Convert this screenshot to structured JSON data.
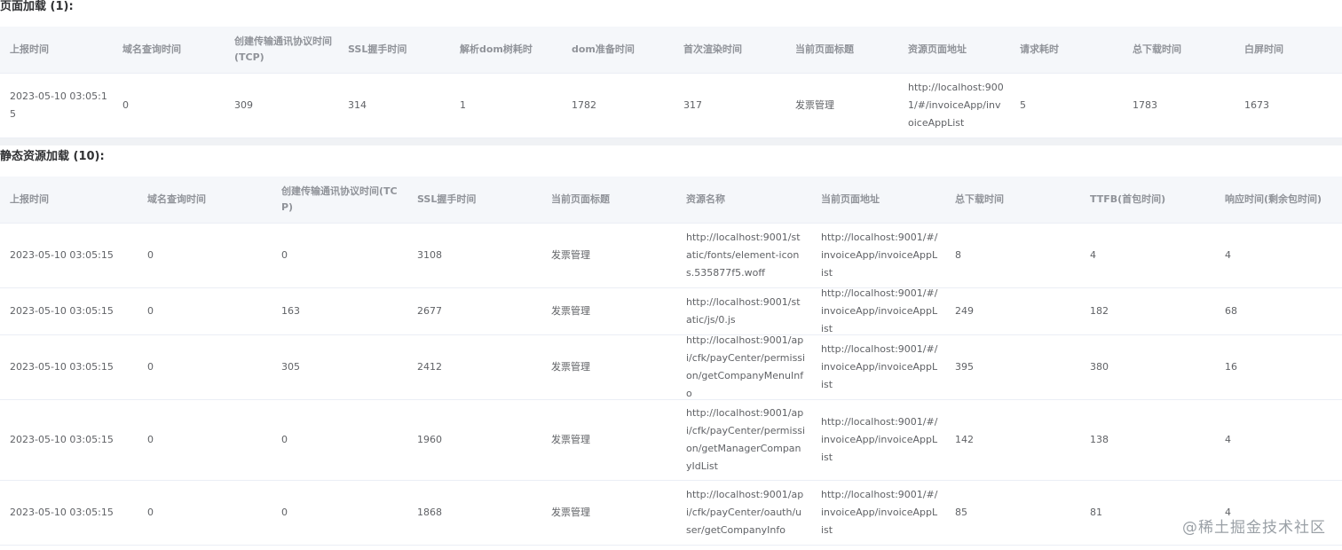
{
  "page_load": {
    "title": "页面加载 (1):",
    "columns": [
      "上报时间",
      "域名查询时间",
      "创建传输通讯协议时间(TCP)",
      "SSL握手时间",
      "解析dom树耗时",
      "dom准备时间",
      "首次渲染时间",
      "当前页面标题",
      "资源页面地址",
      "请求耗时",
      "总下载时间",
      "白屏时间"
    ],
    "rows": [
      [
        "2023-05-10 03:05:15",
        "0",
        "309",
        "314",
        "1",
        "1782",
        "317",
        "发票管理",
        "http://localhost:9001/#/invoiceApp/invoiceAppList",
        "5",
        "1783",
        "1673"
      ]
    ]
  },
  "static_load": {
    "title": "静态资源加载 (10):",
    "columns": [
      "上报时间",
      "域名查询时间",
      "创建传输通讯协议时间(TCP)",
      "SSL握手时间",
      "当前页面标题",
      "资源名称",
      "当前页面地址",
      "总下载时间",
      "TTFB(首包时间)",
      "响应时间(剩余包时间)"
    ],
    "rows": [
      [
        "2023-05-10 03:05:15",
        "0",
        "0",
        "3108",
        "发票管理",
        "http://localhost:9001/static/fonts/element-icons.535877f5.woff",
        "http://localhost:9001/#/invoiceApp/invoiceAppList",
        "8",
        "4",
        "4"
      ],
      [
        "2023-05-10 03:05:15",
        "0",
        "163",
        "2677",
        "发票管理",
        "http://localhost:9001/static/js/0.js",
        "http://localhost:9001/#/invoiceApp/invoiceAppList",
        "249",
        "182",
        "68"
      ],
      [
        "2023-05-10 03:05:15",
        "0",
        "305",
        "2412",
        "发票管理",
        "http://localhost:9001/api/cfk/payCenter/permission/getCompanyMenuInfo",
        "http://localhost:9001/#/invoiceApp/invoiceAppList",
        "395",
        "380",
        "16"
      ],
      [
        "2023-05-10 03:05:15",
        "0",
        "0",
        "1960",
        "发票管理",
        "http://localhost:9001/api/cfk/payCenter/permission/getManagerCompanyIdList",
        "http://localhost:9001/#/invoiceApp/invoiceAppList",
        "142",
        "138",
        "4"
      ],
      [
        "2023-05-10 03:05:15",
        "0",
        "0",
        "1868",
        "发票管理",
        "http://localhost:9001/api/cfk/payCenter/oauth/user/getCompanyInfo",
        "http://localhost:9001/#/invoiceApp/invoiceAppList",
        "85",
        "81",
        "4"
      ]
    ]
  },
  "watermark": "@稀土掘金技术社区"
}
